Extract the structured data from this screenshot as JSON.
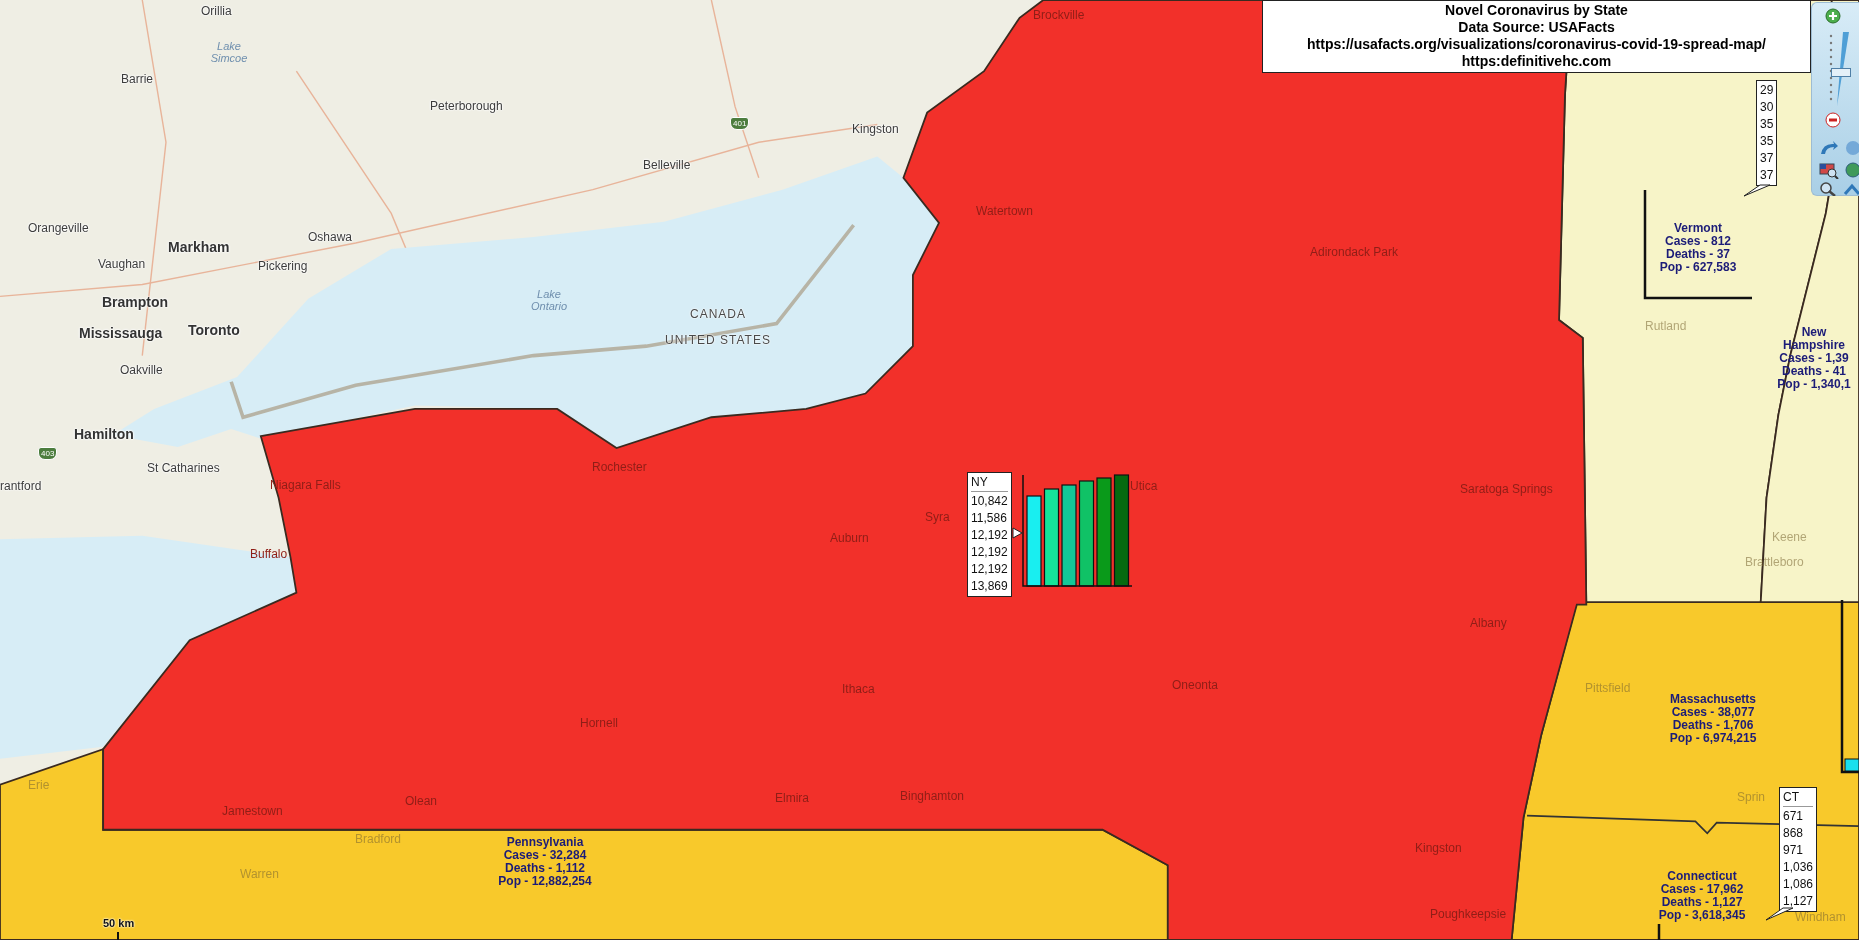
{
  "title_box": {
    "lines": [
      "Novel Coronavirus by State",
      "Data Source: USAFacts",
      "https://usafacts.org/visualizations/coronavirus-covid-19-spread-map/",
      "https:definitivehc.com"
    ]
  },
  "map_labels": [
    {
      "text": "Orillia",
      "kind": "city"
    },
    {
      "text": "Lake Simcoe",
      "kind": "water"
    },
    {
      "text": "Barrie",
      "kind": "city"
    },
    {
      "text": "Peterborough",
      "kind": "city"
    },
    {
      "text": "Kingston",
      "kind": "city"
    },
    {
      "text": "Brockville",
      "kind": "shaded"
    },
    {
      "text": "Belleville",
      "kind": "city"
    },
    {
      "text": "Orangeville",
      "kind": "city"
    },
    {
      "text": "Oshawa",
      "kind": "city"
    },
    {
      "text": "Markham",
      "kind": "major"
    },
    {
      "text": "Vaughan",
      "kind": "city"
    },
    {
      "text": "Pickering",
      "kind": "city"
    },
    {
      "text": "Brampton",
      "kind": "major"
    },
    {
      "text": "Mississauga",
      "kind": "major"
    },
    {
      "text": "Toronto",
      "kind": "major"
    },
    {
      "text": "Oakville",
      "kind": "city"
    },
    {
      "text": "Hamilton",
      "kind": "major"
    },
    {
      "text": "St Catharines",
      "kind": "city"
    },
    {
      "text": "rantford",
      "kind": "city"
    },
    {
      "text": "Niagara Falls",
      "kind": "shaded"
    },
    {
      "text": "Buffalo",
      "kind": "shaded"
    },
    {
      "text": "Lake Ontario",
      "kind": "water"
    },
    {
      "text": "CANADA",
      "kind": "border"
    },
    {
      "text": "UNITED STATES",
      "kind": "border"
    },
    {
      "text": "Rochester",
      "kind": "shaded"
    },
    {
      "text": "Watertown",
      "kind": "shaded"
    },
    {
      "text": "Adirondack Park",
      "kind": "shaded"
    },
    {
      "text": "Syra",
      "kind": "shaded"
    },
    {
      "text": "Utica",
      "kind": "shaded"
    },
    {
      "text": "Auburn",
      "kind": "shaded"
    },
    {
      "text": "Saratoga Springs",
      "kind": "shaded"
    },
    {
      "text": "Albany",
      "kind": "shaded"
    },
    {
      "text": "Ithaca",
      "kind": "shaded"
    },
    {
      "text": "Oneonta",
      "kind": "shaded"
    },
    {
      "text": "Hornell",
      "kind": "shaded"
    },
    {
      "text": "Jamestown",
      "kind": "shaded"
    },
    {
      "text": "Olean",
      "kind": "shaded"
    },
    {
      "text": "Elmira",
      "kind": "shaded"
    },
    {
      "text": "Binghamton",
      "kind": "shaded"
    },
    {
      "text": "Kingston",
      "kind": "shaded"
    },
    {
      "text": "Poughkeepsie",
      "kind": "shaded"
    },
    {
      "text": "Bradford",
      "kind": "muted"
    },
    {
      "text": "Warren",
      "kind": "muted"
    },
    {
      "text": "Erie",
      "kind": "muted"
    },
    {
      "text": "Rutland",
      "kind": "muted"
    },
    {
      "text": "Keene",
      "kind": "muted"
    },
    {
      "text": "Brattleboro",
      "kind": "muted"
    },
    {
      "text": "Pittsfield",
      "kind": "muted"
    },
    {
      "text": "Sprin",
      "kind": "muted"
    },
    {
      "text": "Windham",
      "kind": "muted"
    },
    {
      "text": "401",
      "kind": "shield"
    },
    {
      "text": "403",
      "kind": "shield"
    }
  ],
  "state_labels": [
    {
      "name": "Vermont",
      "lines": [
        "Cases - 812",
        "Deaths - 37",
        "Pop - 627,583"
      ]
    },
    {
      "name": "New Hampshire",
      "lines": [
        "Cases - 1,39",
        "Deaths - 41",
        "Pop - 1,340,1"
      ]
    },
    {
      "name": "Massachusetts",
      "lines": [
        "Cases - 38,077",
        "Deaths - 1,706",
        "Pop - 6,974,215"
      ]
    },
    {
      "name": "Connecticut",
      "lines": [
        "Cases - 17,962",
        "Deaths - 1,127",
        "Pop - 3,618,345"
      ]
    },
    {
      "name": "Pennsylvania",
      "lines": [
        "Cases - 32,284",
        "Deaths - 1,112",
        "Pop - 12,882,254"
      ]
    }
  ],
  "callouts": [
    {
      "title": "NY",
      "values": [
        "10,842",
        "11,586",
        "12,192",
        "12,192",
        "12,192",
        "13,869"
      ]
    },
    {
      "values": [
        "29",
        "30",
        "35",
        "35",
        "37",
        "37"
      ]
    },
    {
      "title": "CT",
      "values": [
        "671",
        "868",
        "971",
        "1,036",
        "1,086",
        "1,127"
      ]
    }
  ],
  "scale_bar": {
    "label": "50 km"
  },
  "zoom_slider": {
    "level": 0.45
  }
}
